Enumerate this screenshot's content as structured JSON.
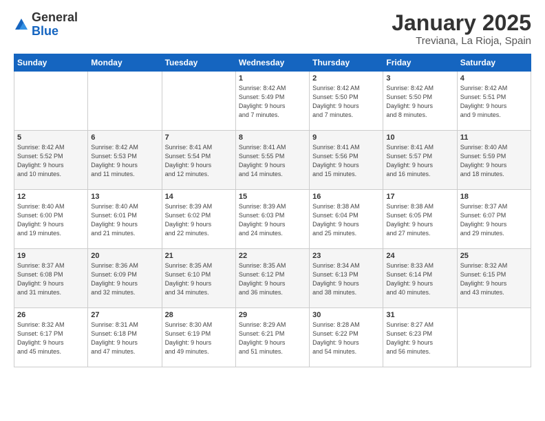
{
  "logo": {
    "general": "General",
    "blue": "Blue"
  },
  "header": {
    "month_year": "January 2025",
    "location": "Treviana, La Rioja, Spain"
  },
  "days_of_week": [
    "Sunday",
    "Monday",
    "Tuesday",
    "Wednesday",
    "Thursday",
    "Friday",
    "Saturday"
  ],
  "weeks": [
    [
      {
        "day": "",
        "info": ""
      },
      {
        "day": "",
        "info": ""
      },
      {
        "day": "",
        "info": ""
      },
      {
        "day": "1",
        "info": "Sunrise: 8:42 AM\nSunset: 5:49 PM\nDaylight: 9 hours\nand 7 minutes."
      },
      {
        "day": "2",
        "info": "Sunrise: 8:42 AM\nSunset: 5:50 PM\nDaylight: 9 hours\nand 7 minutes."
      },
      {
        "day": "3",
        "info": "Sunrise: 8:42 AM\nSunset: 5:50 PM\nDaylight: 9 hours\nand 8 minutes."
      },
      {
        "day": "4",
        "info": "Sunrise: 8:42 AM\nSunset: 5:51 PM\nDaylight: 9 hours\nand 9 minutes."
      }
    ],
    [
      {
        "day": "5",
        "info": "Sunrise: 8:42 AM\nSunset: 5:52 PM\nDaylight: 9 hours\nand 10 minutes."
      },
      {
        "day": "6",
        "info": "Sunrise: 8:42 AM\nSunset: 5:53 PM\nDaylight: 9 hours\nand 11 minutes."
      },
      {
        "day": "7",
        "info": "Sunrise: 8:41 AM\nSunset: 5:54 PM\nDaylight: 9 hours\nand 12 minutes."
      },
      {
        "day": "8",
        "info": "Sunrise: 8:41 AM\nSunset: 5:55 PM\nDaylight: 9 hours\nand 14 minutes."
      },
      {
        "day": "9",
        "info": "Sunrise: 8:41 AM\nSunset: 5:56 PM\nDaylight: 9 hours\nand 15 minutes."
      },
      {
        "day": "10",
        "info": "Sunrise: 8:41 AM\nSunset: 5:57 PM\nDaylight: 9 hours\nand 16 minutes."
      },
      {
        "day": "11",
        "info": "Sunrise: 8:40 AM\nSunset: 5:59 PM\nDaylight: 9 hours\nand 18 minutes."
      }
    ],
    [
      {
        "day": "12",
        "info": "Sunrise: 8:40 AM\nSunset: 6:00 PM\nDaylight: 9 hours\nand 19 minutes."
      },
      {
        "day": "13",
        "info": "Sunrise: 8:40 AM\nSunset: 6:01 PM\nDaylight: 9 hours\nand 21 minutes."
      },
      {
        "day": "14",
        "info": "Sunrise: 8:39 AM\nSunset: 6:02 PM\nDaylight: 9 hours\nand 22 minutes."
      },
      {
        "day": "15",
        "info": "Sunrise: 8:39 AM\nSunset: 6:03 PM\nDaylight: 9 hours\nand 24 minutes."
      },
      {
        "day": "16",
        "info": "Sunrise: 8:38 AM\nSunset: 6:04 PM\nDaylight: 9 hours\nand 25 minutes."
      },
      {
        "day": "17",
        "info": "Sunrise: 8:38 AM\nSunset: 6:05 PM\nDaylight: 9 hours\nand 27 minutes."
      },
      {
        "day": "18",
        "info": "Sunrise: 8:37 AM\nSunset: 6:07 PM\nDaylight: 9 hours\nand 29 minutes."
      }
    ],
    [
      {
        "day": "19",
        "info": "Sunrise: 8:37 AM\nSunset: 6:08 PM\nDaylight: 9 hours\nand 31 minutes."
      },
      {
        "day": "20",
        "info": "Sunrise: 8:36 AM\nSunset: 6:09 PM\nDaylight: 9 hours\nand 32 minutes."
      },
      {
        "day": "21",
        "info": "Sunrise: 8:35 AM\nSunset: 6:10 PM\nDaylight: 9 hours\nand 34 minutes."
      },
      {
        "day": "22",
        "info": "Sunrise: 8:35 AM\nSunset: 6:12 PM\nDaylight: 9 hours\nand 36 minutes."
      },
      {
        "day": "23",
        "info": "Sunrise: 8:34 AM\nSunset: 6:13 PM\nDaylight: 9 hours\nand 38 minutes."
      },
      {
        "day": "24",
        "info": "Sunrise: 8:33 AM\nSunset: 6:14 PM\nDaylight: 9 hours\nand 40 minutes."
      },
      {
        "day": "25",
        "info": "Sunrise: 8:32 AM\nSunset: 6:15 PM\nDaylight: 9 hours\nand 43 minutes."
      }
    ],
    [
      {
        "day": "26",
        "info": "Sunrise: 8:32 AM\nSunset: 6:17 PM\nDaylight: 9 hours\nand 45 minutes."
      },
      {
        "day": "27",
        "info": "Sunrise: 8:31 AM\nSunset: 6:18 PM\nDaylight: 9 hours\nand 47 minutes."
      },
      {
        "day": "28",
        "info": "Sunrise: 8:30 AM\nSunset: 6:19 PM\nDaylight: 9 hours\nand 49 minutes."
      },
      {
        "day": "29",
        "info": "Sunrise: 8:29 AM\nSunset: 6:21 PM\nDaylight: 9 hours\nand 51 minutes."
      },
      {
        "day": "30",
        "info": "Sunrise: 8:28 AM\nSunset: 6:22 PM\nDaylight: 9 hours\nand 54 minutes."
      },
      {
        "day": "31",
        "info": "Sunrise: 8:27 AM\nSunset: 6:23 PM\nDaylight: 9 hours\nand 56 minutes."
      },
      {
        "day": "",
        "info": ""
      }
    ]
  ]
}
